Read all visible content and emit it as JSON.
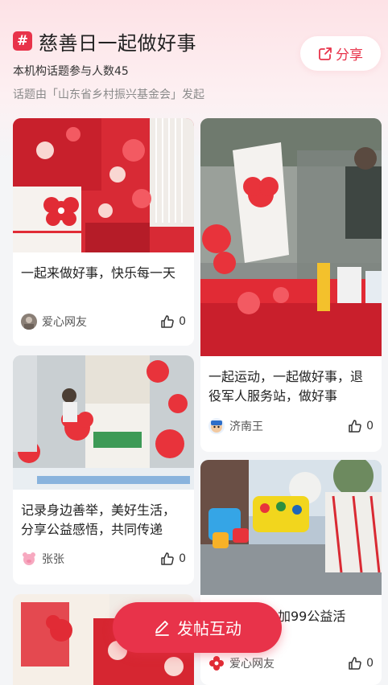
{
  "header": {
    "hash_symbol": "#",
    "topic_title": "慈善日一起做好事",
    "participants": "本机构话题参与人数45",
    "initiator": "话题由「山东省乡村振兴基金会」发起",
    "share_label": "分享"
  },
  "posts": [
    {
      "title": "一起来做好事，快乐每一天",
      "author": "爱心网友",
      "likes": "0"
    },
    {
      "title": "一起运动，一起做好事，退役军人服务站，做好事",
      "author": "济南王",
      "likes": "0"
    },
    {
      "title": "记录身边善举，美好生活，分享公益感悟，共同传递",
      "author": "张张",
      "likes": "0"
    },
    {
      "title": "参加99公益活",
      "author": "爱心网友",
      "likes": "0"
    }
  ],
  "post_button_label": "发帖互动",
  "colors": {
    "accent": "#e8334a",
    "background": "#f4f5f7"
  }
}
